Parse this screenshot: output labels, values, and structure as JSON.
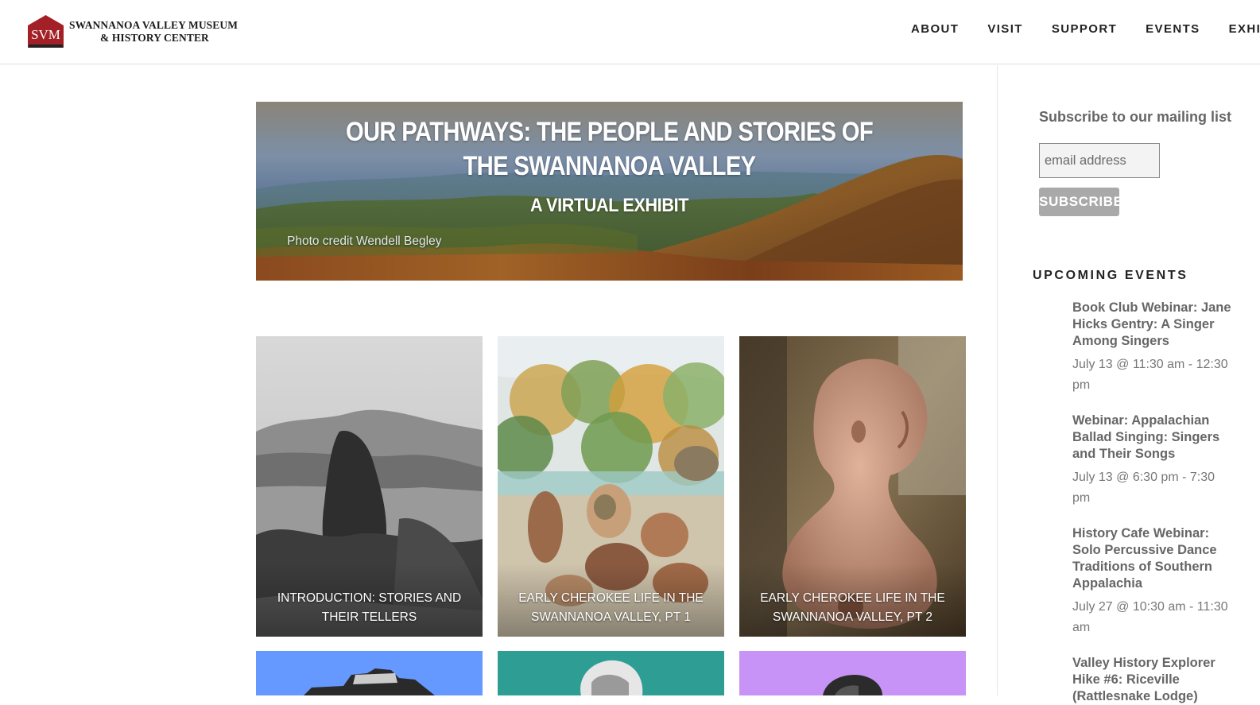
{
  "header": {
    "logo_mark": "SVM",
    "logo_line1": "SWANNANOA VALLEY MUSEUM",
    "logo_line2": "& HISTORY CENTER",
    "brand_color": "#a32027",
    "nav": [
      "ABOUT",
      "VISIT",
      "SUPPORT",
      "EVENTS",
      "EXHI"
    ]
  },
  "hero": {
    "title": "OUR PATHWAYS: THE PEOPLE AND STORIES OF THE SWANNANOA VALLEY",
    "subtitle": "A VIRTUAL EXHIBIT",
    "credit": "Photo credit Wendell Begley"
  },
  "cards": [
    {
      "caption": "INTRODUCTION: STORIES AND THEIR TELLERS",
      "image": "black-and-white mountain landscape"
    },
    {
      "caption": "EARLY CHEROKEE LIFE IN THE SWANNANOA VALLEY, PT 1",
      "image": "painting of Cherokee village life"
    },
    {
      "caption": "EARLY CHEROKEE LIFE IN THE SWANNANOA VALLEY, PT 2",
      "image": "clay effigy pipe figure"
    },
    {
      "caption": "",
      "image": "stone structure on blue background",
      "bg": "#6699ff"
    },
    {
      "caption": "",
      "image": "portrait on teal background",
      "bg": "#2e9e95"
    },
    {
      "caption": "",
      "image": "portrait on violet background",
      "bg": "#c893f7"
    }
  ],
  "sidebar": {
    "subscribe_title": "Subscribe to our mailing list",
    "email_placeholder": "email address",
    "subscribe_button": "SUBSCRIBE",
    "events_title": "UPCOMING EVENTS",
    "events": [
      {
        "title": "Book Club Webinar: Jane Hicks Gentry: A Singer Among Singers",
        "date": "July 13 @ 11:30 am - 12:30 pm"
      },
      {
        "title": "Webinar: Appalachian Ballad Singing: Singers and Their Songs",
        "date": "July 13 @ 6:30 pm - 7:30 pm"
      },
      {
        "title": "History Cafe Webinar: Solo Percussive Dance Traditions of Southern Appalachia",
        "date": "July 27 @ 10:30 am - 11:30 am"
      },
      {
        "title": "Valley History Explorer Hike #6: Riceville (Rattlesnake Lodge)",
        "date": ""
      }
    ]
  }
}
